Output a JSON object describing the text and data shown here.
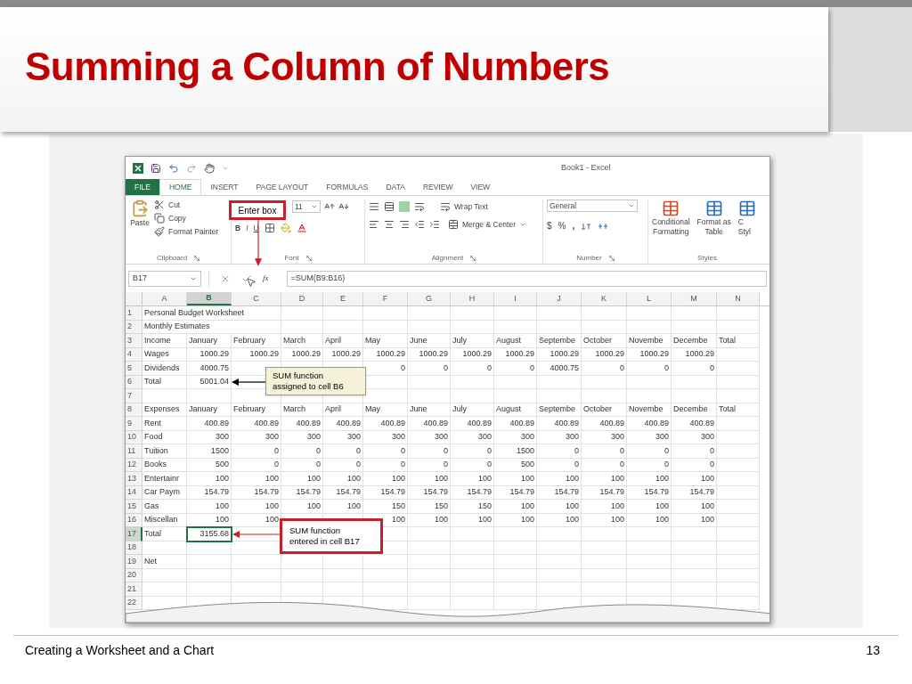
{
  "slide": {
    "title": "Summing a Column of Numbers",
    "footer": "Creating a Worksheet and a Chart",
    "page_number": "13"
  },
  "excel": {
    "window_title": "Book1 - Excel",
    "tabs": [
      {
        "label": "FILE",
        "kind": "file",
        "selected": false
      },
      {
        "label": "HOME",
        "kind": "tab",
        "selected": true
      },
      {
        "label": "INSERT",
        "kind": "tab",
        "selected": false
      },
      {
        "label": "PAGE LAYOUT",
        "kind": "tab",
        "selected": false
      },
      {
        "label": "FORMULAS",
        "kind": "tab",
        "selected": false
      },
      {
        "label": "DATA",
        "kind": "tab",
        "selected": false
      },
      {
        "label": "REVIEW",
        "kind": "tab",
        "selected": false
      },
      {
        "label": "VIEW",
        "kind": "tab",
        "selected": false
      }
    ],
    "clipboard": {
      "paste": "Paste",
      "cut": "Cut",
      "copy": "Copy",
      "format_painter": "Format Painter",
      "label": "Clipboard"
    },
    "font": {
      "size": "11",
      "bold": "B",
      "italic": "I",
      "underline": "U",
      "label": "Font"
    },
    "alignment": {
      "wrap_text": "Wrap Text",
      "merge": "Merge & Center",
      "label": "Alignment"
    },
    "number": {
      "format": "General",
      "currency": "$",
      "percent": "%",
      "comma": ",",
      "label": "Number"
    },
    "styles": {
      "conditional": [
        "Conditional",
        "Formatting"
      ],
      "format_table": [
        "Format as",
        "Table"
      ],
      "cell_styles": [
        "C",
        "Styl"
      ],
      "label": "Styles"
    },
    "formula_bar": {
      "name_box": "B17",
      "function_label": "fx",
      "formula": "=SUM(B9:B16)"
    },
    "grid": {
      "columns": [
        {
          "label": "A",
          "selected": false
        },
        {
          "label": "B",
          "selected": true
        },
        {
          "label": "C",
          "selected": false
        },
        {
          "label": "D",
          "selected": false
        },
        {
          "label": "E",
          "selected": false
        },
        {
          "label": "F",
          "selected": false
        },
        {
          "label": "G",
          "selected": false
        },
        {
          "label": "H",
          "selected": false
        },
        {
          "label": "I",
          "selected": false
        },
        {
          "label": "J",
          "selected": false
        },
        {
          "label": "K",
          "selected": false
        },
        {
          "label": "L",
          "selected": false
        },
        {
          "label": "M",
          "selected": false
        },
        {
          "label": "N",
          "selected": false
        }
      ],
      "rows": [
        {
          "number": "1",
          "kind": "title",
          "selected": false,
          "cells": [
            "Personal Budget Worksheet"
          ]
        },
        {
          "number": "2",
          "kind": "title",
          "selected": false,
          "cells": [
            "Monthly Estimates"
          ]
        },
        {
          "number": "3",
          "kind": "text",
          "selected": false,
          "cells": [
            "Income",
            "January",
            "February",
            "March",
            "April",
            "May",
            "June",
            "July",
            "August",
            "Septembe",
            "October",
            "Novembe",
            "Decembe",
            "Total"
          ]
        },
        {
          "number": "4",
          "kind": "values",
          "selected": false,
          "cells": [
            "Wages",
            "1000.29",
            "1000.29",
            "1000.29",
            "1000.29",
            "1000.29",
            "1000.29",
            "1000.29",
            "1000.29",
            "1000.29",
            "1000.29",
            "1000.29",
            "1000.29"
          ]
        },
        {
          "number": "5",
          "kind": "values",
          "selected": false,
          "cells": [
            "Dividends",
            "4000.75",
            null,
            null,
            null,
            "0",
            "0",
            "0",
            "0",
            "4000.75",
            "0",
            "0",
            "0"
          ]
        },
        {
          "number": "6",
          "kind": "values",
          "selected": false,
          "cells": [
            "Total",
            "5001.04"
          ]
        },
        {
          "number": "7",
          "kind": "text",
          "selected": false
        },
        {
          "number": "8",
          "kind": "text",
          "selected": false,
          "cells": [
            "Expenses",
            "January",
            "February",
            "March",
            "April",
            "May",
            "June",
            "July",
            "August",
            "Septembe",
            "October",
            "Novembe",
            "Decembe",
            "Total"
          ]
        },
        {
          "number": "9",
          "kind": "values",
          "selected": false,
          "cells": [
            "Rent",
            "400.89",
            "400.89",
            "400.89",
            "400.89",
            "400.89",
            "400.89",
            "400.89",
            "400.89",
            "400.89",
            "400.89",
            "400.89",
            "400.89"
          ]
        },
        {
          "number": "10",
          "kind": "values",
          "selected": false,
          "cells": [
            "Food",
            "300",
            "300",
            "300",
            "300",
            "300",
            "300",
            "300",
            "300",
            "300",
            "300",
            "300",
            "300"
          ]
        },
        {
          "number": "11",
          "kind": "values",
          "selected": false,
          "cells": [
            "Tuition",
            "1500",
            "0",
            "0",
            "0",
            "0",
            "0",
            "0",
            "1500",
            "0",
            "0",
            "0",
            "0"
          ]
        },
        {
          "number": "12",
          "kind": "values",
          "selected": false,
          "cells": [
            "Books",
            "500",
            "0",
            "0",
            "0",
            "0",
            "0",
            "0",
            "500",
            "0",
            "0",
            "0",
            "0"
          ]
        },
        {
          "number": "13",
          "kind": "values",
          "selected": false,
          "cells": [
            "Entertainr",
            "100",
            "100",
            "100",
            "100",
            "100",
            "100",
            "100",
            "100",
            "100",
            "100",
            "100",
            "100"
          ]
        },
        {
          "number": "14",
          "kind": "values",
          "selected": false,
          "cells": [
            "Car Paym",
            "154.79",
            "154.79",
            "154.79",
            "154.79",
            "154.79",
            "154.79",
            "154.79",
            "154.79",
            "154.79",
            "154.79",
            "154.79",
            "154.79"
          ]
        },
        {
          "number": "15",
          "kind": "values",
          "selected": false,
          "cells": [
            "Gas",
            "100",
            "100",
            "100",
            "100",
            "150",
            "150",
            "150",
            "100",
            "100",
            "100",
            "100",
            "100"
          ]
        },
        {
          "number": "16",
          "kind": "values",
          "selected": false,
          "cells": [
            "Miscellan",
            "100",
            "100",
            null,
            null,
            "100",
            "100",
            "100",
            "100",
            "100",
            "100",
            "100",
            "100"
          ]
        },
        {
          "number": "17",
          "kind": "values",
          "selected": true,
          "cells": [
            "Total",
            "3155.68"
          ]
        },
        {
          "number": "18",
          "kind": "text",
          "selected": false
        },
        {
          "number": "19",
          "kind": "text",
          "selected": false,
          "cells": [
            "Net"
          ]
        },
        {
          "number": "20",
          "kind": "text",
          "selected": false
        },
        {
          "number": "21",
          "kind": "text",
          "selected": false
        },
        {
          "number": "22",
          "kind": "text",
          "selected": false
        }
      ]
    },
    "callouts": [
      {
        "kind": "enter-box",
        "lines": [
          "Enter box"
        ]
      },
      {
        "kind": "assigned",
        "lines": [
          "SUM function",
          "assigned to cell B6"
        ]
      },
      {
        "kind": "entered",
        "lines": [
          "SUM function",
          "entered in cell B17"
        ]
      }
    ]
  }
}
